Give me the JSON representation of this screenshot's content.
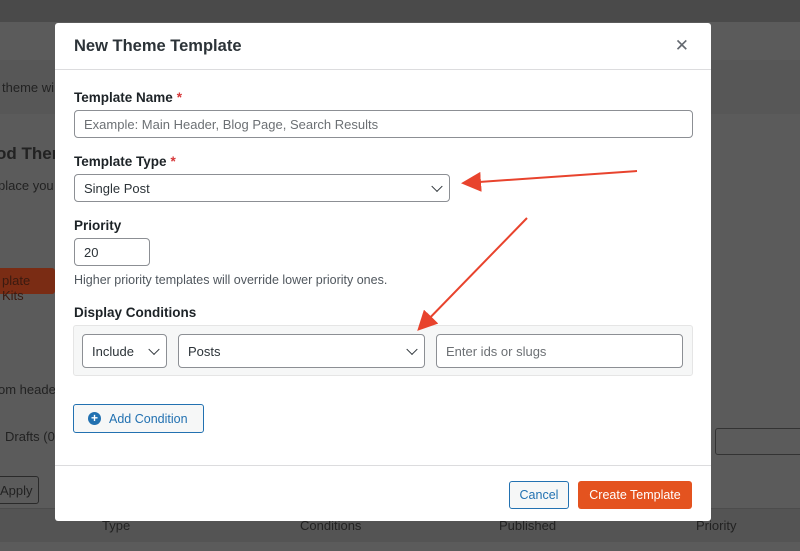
{
  "background": {
    "fragment_1": "theme wi",
    "heading": "od Them",
    "fragment_2": "place you",
    "kits_button": "plate Kits",
    "fragment_3": "om heade",
    "drafts": "Drafts (0",
    "apply_button": "Apply",
    "table_headers": [
      "Type",
      "Conditions",
      "Published",
      "Priority"
    ]
  },
  "modal": {
    "title": "New Theme Template",
    "close_icon": "close-icon",
    "template_name": {
      "label": "Template Name",
      "required": "*",
      "placeholder": "Example: Main Header, Blog Page, Search Results",
      "value": ""
    },
    "template_type": {
      "label": "Template Type",
      "required": "*",
      "value": "Single Post"
    },
    "priority": {
      "label": "Priority",
      "value": "20",
      "hint": "Higher priority templates will override lower priority ones."
    },
    "display_conditions": {
      "label": "Display Conditions",
      "mode": "Include",
      "target": "Posts",
      "ids_placeholder": "Enter ids or slugs"
    },
    "add_condition": "Add Condition",
    "cancel": "Cancel",
    "create": "Create Template"
  },
  "colors": {
    "accent": "#2271b1",
    "primary_button": "#e4531f",
    "annotation_arrow": "#e8432d"
  }
}
